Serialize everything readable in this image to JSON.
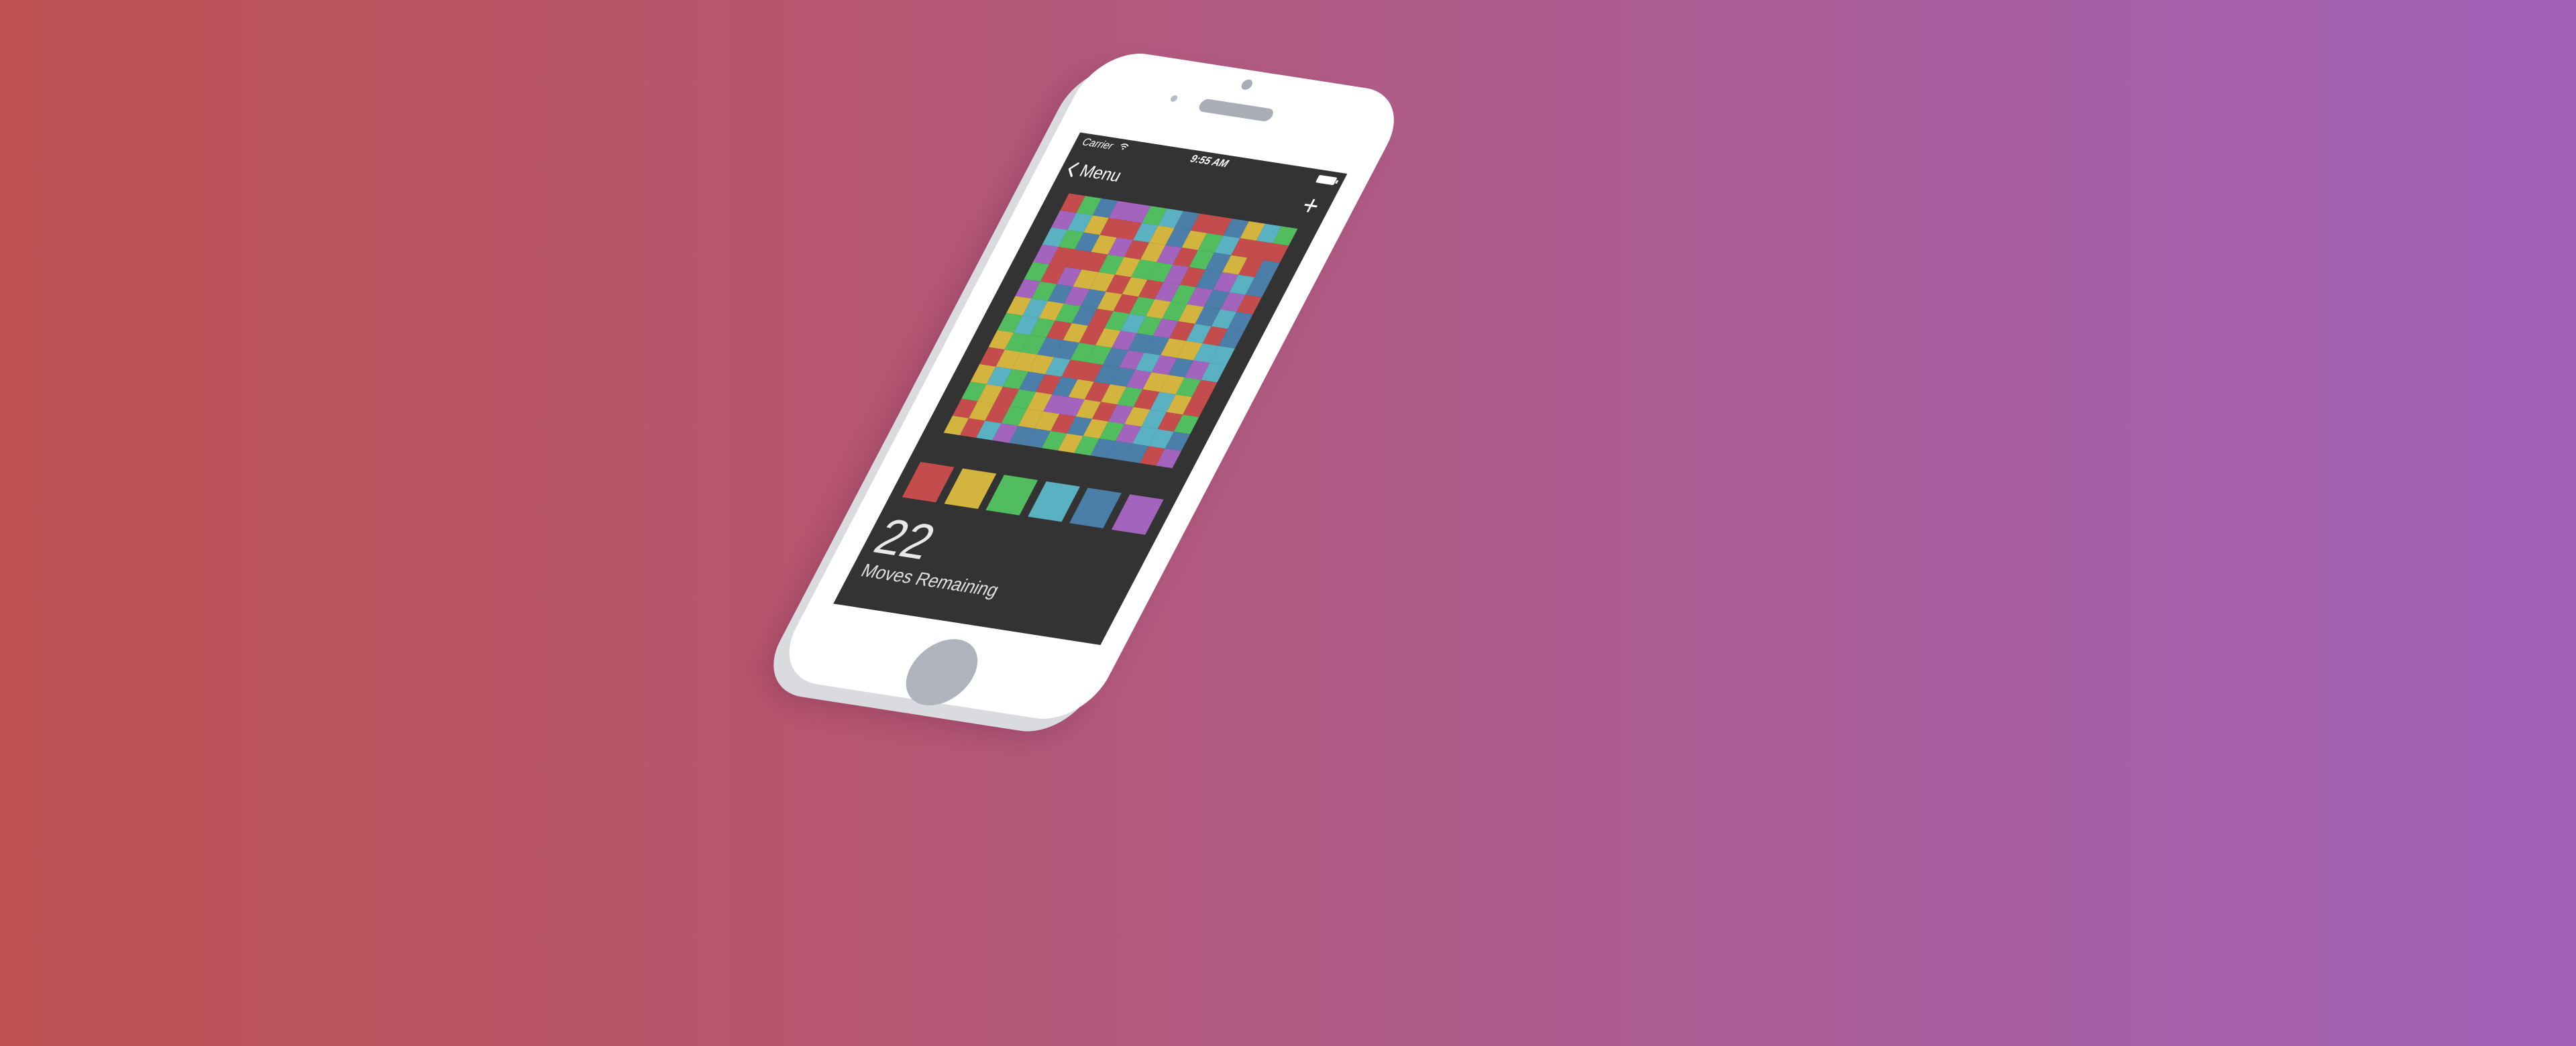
{
  "colors": {
    "red": "#c54c4c",
    "yellow": "#d2b43f",
    "green": "#52bd5e",
    "teal": "#5ab1c1",
    "blue": "#4b7ea8",
    "purple": "#a264bd",
    "screen": "#333333"
  },
  "status_bar": {
    "carrier": "Carrier",
    "time": "9:55 AM",
    "wifi_icon": "wifi-icon",
    "battery_icon": "battery-icon"
  },
  "nav": {
    "back_label": "Menu",
    "back_icon": "chevron-left-icon",
    "add_label": "+"
  },
  "board": {
    "size": 14,
    "rows": [
      "rgbppgtbrrbytg",
      "ptyrrtybygtrrr",
      "tgbypryprgbyrb",
      "prrrgyggprbptb",
      "grpyyryrpgpbpr",
      "pgbpbyrgygybtb",
      "ytygbrgtgprtrb",
      "gtgryrypbbyytt",
      "yggbbggbptpbpt",
      "ryyytrrbbpyygr",
      "ytgbrbyrygrtyr",
      "gyrgyppyrpytrg",
      "ryrgyyrbygpttb",
      "yrtpbbgygbbbrp"
    ],
    "palette": {
      "r": "red",
      "y": "yellow",
      "g": "green",
      "t": "teal",
      "b": "blue",
      "p": "purple"
    }
  },
  "swatches": [
    "red",
    "yellow",
    "green",
    "teal",
    "blue",
    "purple"
  ],
  "moves": {
    "count": "22",
    "label": "Moves Remaining"
  }
}
